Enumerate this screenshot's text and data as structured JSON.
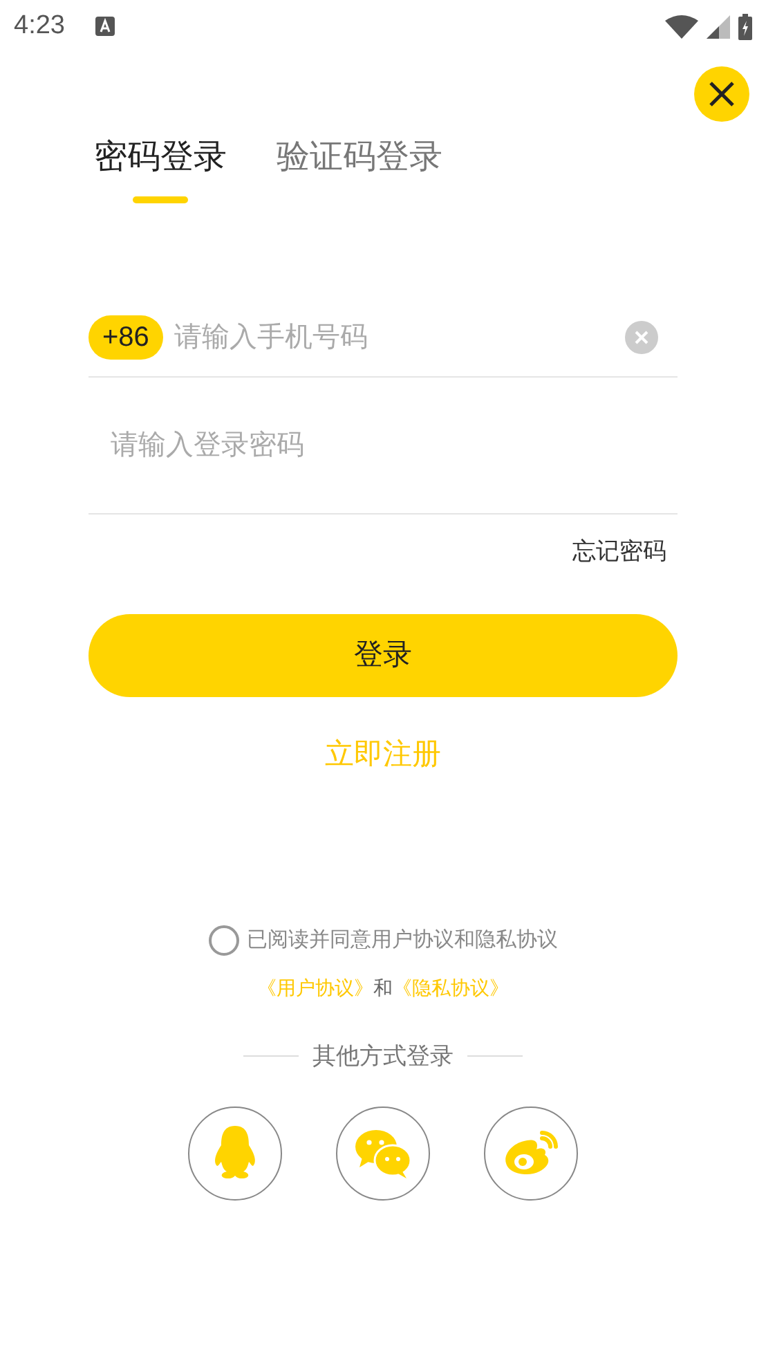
{
  "status_bar": {
    "time": "4:23"
  },
  "tabs": [
    {
      "label": "密码登录",
      "selected": true
    },
    {
      "label": "验证码登录",
      "selected": false
    }
  ],
  "phone_field": {
    "country_code": "+86",
    "placeholder": "请输入手机号码"
  },
  "password_field": {
    "placeholder": "请输入登录密码"
  },
  "forgot_password": "忘记密码",
  "login_button": "登录",
  "register_link": "立即注册",
  "agreement": {
    "checked": false,
    "text": "已阅读并同意用户协议和隐私协议",
    "user_agreement": "《用户协议》",
    "joiner": "和",
    "privacy_agreement": "《隐私协议》"
  },
  "other_login": {
    "title": "其他方式登录",
    "providers": [
      {
        "kind": "qq"
      },
      {
        "kind": "wechat"
      },
      {
        "kind": "weibo"
      }
    ]
  }
}
